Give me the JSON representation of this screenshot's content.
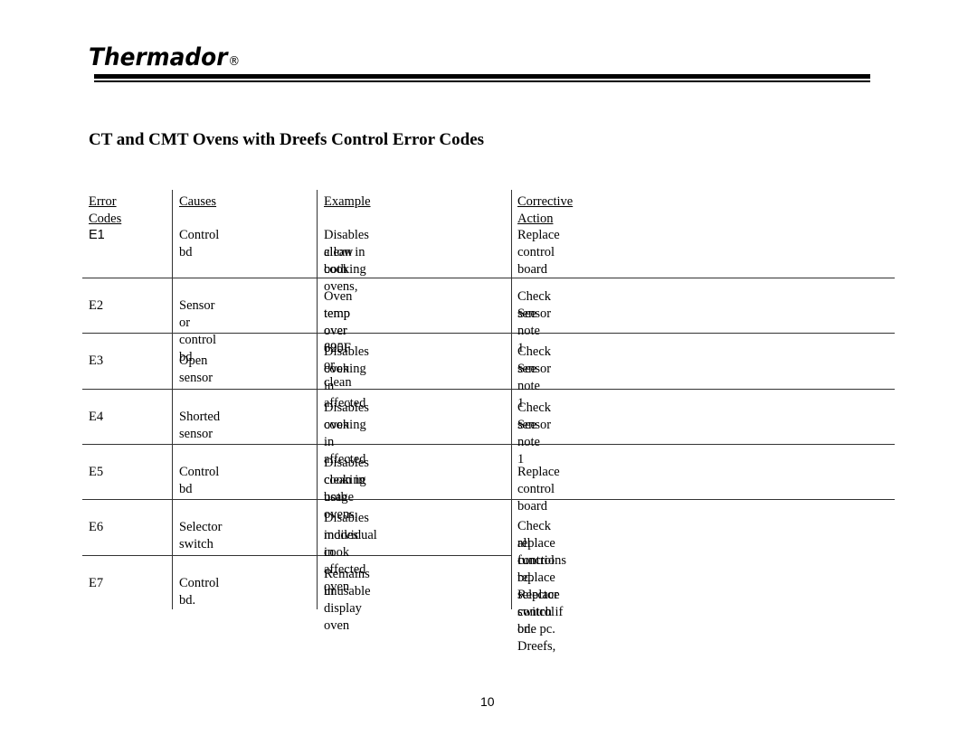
{
  "header": {
    "brand": "Thermador",
    "registered_mark": "®"
  },
  "document": {
    "title": "CT and CMT Ovens with Dreefs Control Error Codes",
    "page_number": "10"
  },
  "table": {
    "columns": [
      "Error Codes",
      "Causes",
      "Example",
      "Corrective Action"
    ],
    "rows": [
      {
        "code": "E1",
        "cause": "Control bd",
        "example": [
          "Disables clean in both ovens,",
          "allow cooking"
        ],
        "action": [
          "Replace control board"
        ]
      },
      {
        "code": "E2",
        "cause": "Sensor or control bd",
        "example": [
          "Oven temp over 625F or clean",
          "temp over 890F"
        ],
        "action": [
          "Check sensor",
          "See note 1"
        ]
      },
      {
        "code": "E3",
        "cause": "Open sensor",
        "example": [
          "Disables cooking in affected",
          "oven"
        ],
        "action": [
          "Check sensor",
          "See note 1"
        ]
      },
      {
        "code": "E4",
        "cause": "Shorted sensor",
        "example": [
          "Disables cooking in affected",
          "oven"
        ],
        "action": [
          "Check sensor",
          "See note 1"
        ]
      },
      {
        "code": "E5",
        "cause": "Control bd",
        "example": [
          "Disables clean in both ovens,",
          "cooking usage"
        ],
        "action": [
          "Replace control board"
        ]
      },
      {
        "code": "E6",
        "cause": "Selector switch",
        "example": [
          "Disables individual cook",
          "modes in affected oven"
        ],
        "action": [
          "Check all functions replace selector switch if one pc. Dreefs,",
          "replace control bd. Replace control bd."
        ]
      },
      {
        "code": "E7",
        "cause": "Control bd.",
        "example": [
          "Remains in display oven",
          "unusable"
        ],
        "action": []
      }
    ]
  }
}
